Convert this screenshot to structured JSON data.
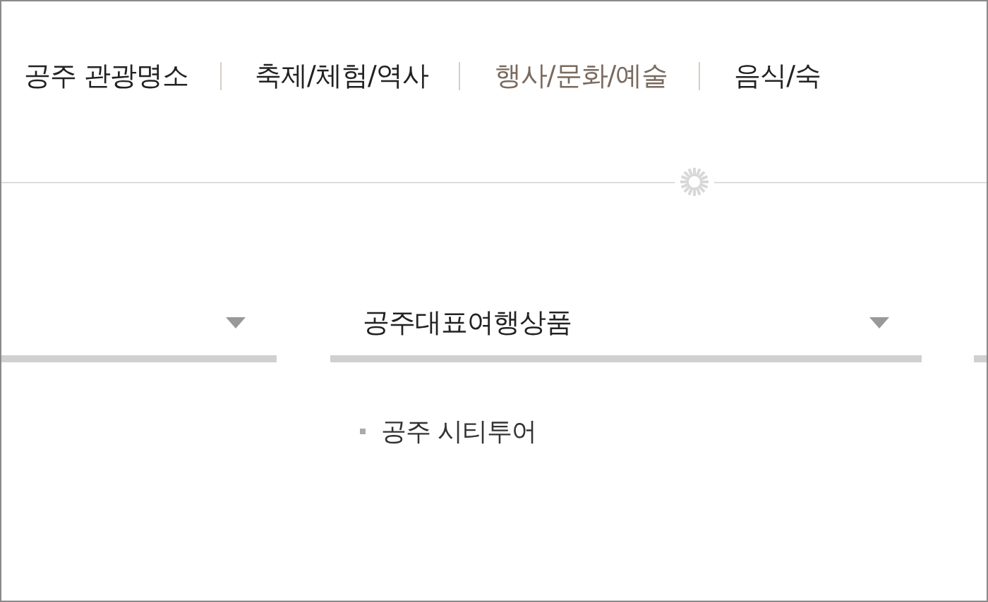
{
  "nav": [
    {
      "label": "공주 관광명소",
      "selected": false
    },
    {
      "label": "축제/체험/역사",
      "selected": false
    },
    {
      "label": "행사/문화/예술",
      "selected": true
    },
    {
      "label": "음식/숙",
      "selected": false
    }
  ],
  "dropdowns": [
    {
      "kind": "cut"
    },
    {
      "kind": "full",
      "value": "공주대표여행상품"
    },
    {
      "kind": "edge"
    }
  ],
  "sub_items": [
    "공주 시티투어"
  ]
}
